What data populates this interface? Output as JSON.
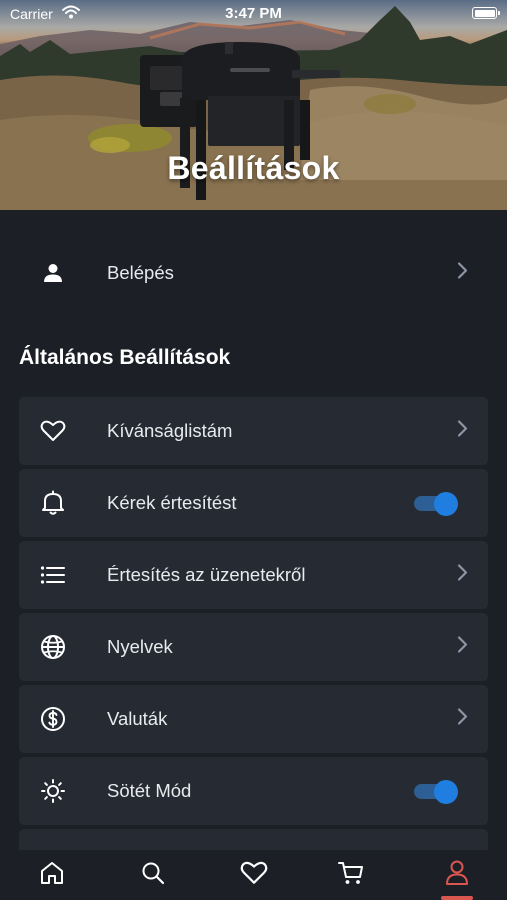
{
  "status_bar": {
    "carrier": "Carrier",
    "time": "3:47 PM"
  },
  "header": {
    "title": "Beállítások"
  },
  "login": {
    "label": "Belépés",
    "icon": "user-icon"
  },
  "general_section": {
    "title": "Általános Beállítások"
  },
  "settings": {
    "items": [
      {
        "label": "Kívánságlistám",
        "icon": "heart-icon",
        "control": "chevron"
      },
      {
        "label": "Kérek értesítést",
        "icon": "bell-icon",
        "control": "toggle",
        "on": true
      },
      {
        "label": "Értesítés az üzenetekről",
        "icon": "list-icon",
        "control": "chevron"
      },
      {
        "label": "Nyelvek",
        "icon": "globe-icon",
        "control": "chevron"
      },
      {
        "label": "Valuták",
        "icon": "dollar-circle-icon",
        "control": "chevron"
      },
      {
        "label": "Sötét Mód",
        "icon": "sun-icon",
        "control": "toggle",
        "on": true
      }
    ]
  },
  "tabbar": {
    "tabs": [
      {
        "icon": "home-icon"
      },
      {
        "icon": "search-icon"
      },
      {
        "icon": "heart-icon"
      },
      {
        "icon": "cart-icon"
      },
      {
        "icon": "user-icon",
        "active": true
      }
    ]
  },
  "colors": {
    "background": "#1c1f26",
    "card": "#262a33",
    "accent": "#1f7ee0",
    "active_tab": "#d9574f",
    "chevron": "#8d95a5"
  }
}
